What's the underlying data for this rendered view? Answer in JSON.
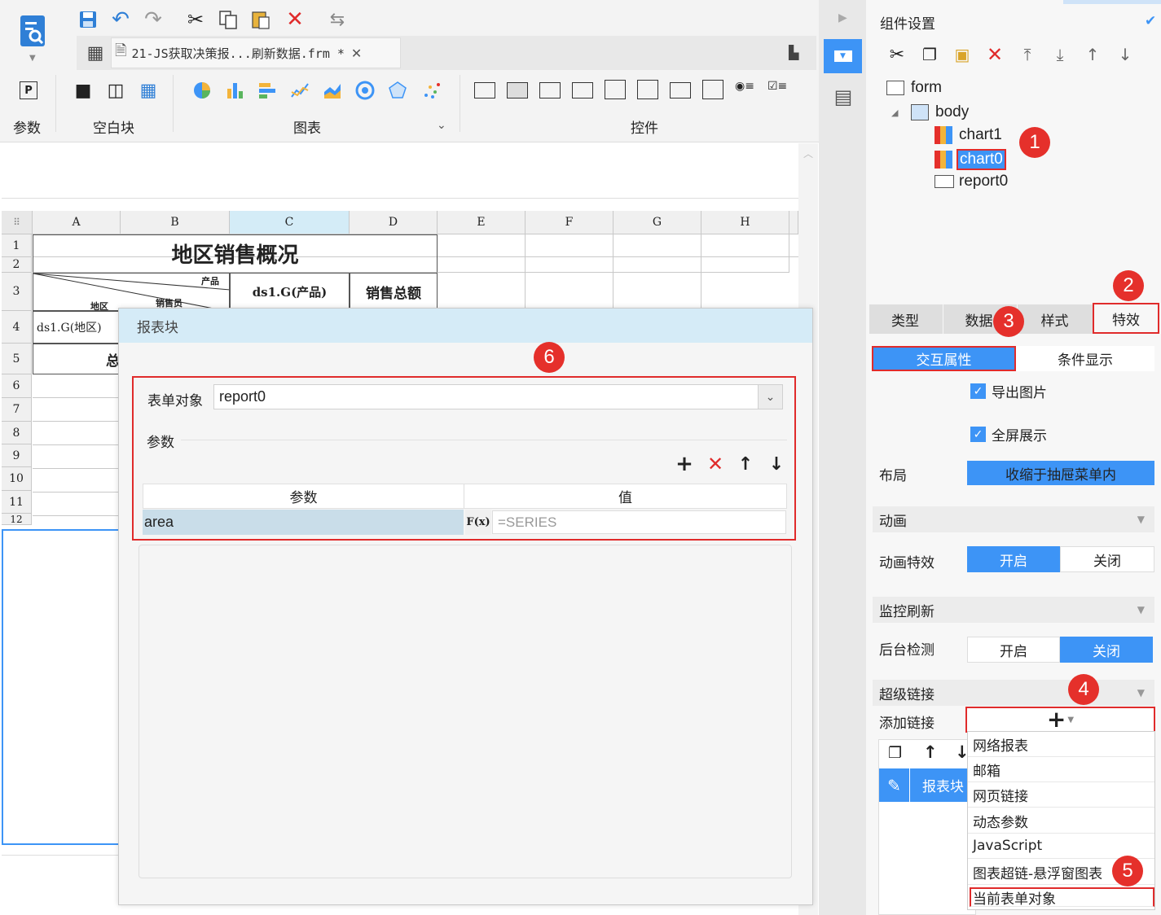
{
  "toolbar": {
    "ribbon_groups": [
      "参数",
      "空白块",
      "图表",
      "控件"
    ]
  },
  "file_tab": {
    "label": "21-JS获取决策报...刷新数据.frm *"
  },
  "sheet": {
    "columns": [
      "A",
      "B",
      "C",
      "D",
      "E",
      "F",
      "G",
      "H"
    ],
    "rows": [
      "1",
      "2",
      "3",
      "4",
      "5",
      "6",
      "7",
      "8",
      "9",
      "10",
      "11",
      "12"
    ],
    "title": "地区销售概况",
    "header_c": "ds1.G(产品)",
    "header_d": "销售总额",
    "diag_top": "产品",
    "diag_mid": "销售员",
    "diag_bot": "地区",
    "cell_a4": "ds1.G(地区)",
    "cell_a5_partial": "总"
  },
  "dialog": {
    "title": "报表块",
    "form_object_label": "表单对象",
    "form_object_value": "report0",
    "params_label": "参数",
    "col_param": "参数",
    "col_value": "值",
    "row_param": "area",
    "row_value": "=SERIES",
    "formula_icon": "F(x)"
  },
  "panel": {
    "title": "组件设置",
    "tree": {
      "form": "form",
      "body": "body",
      "items": [
        "chart1",
        "chart0",
        "report0"
      ]
    },
    "tabs": [
      "类型",
      "数据",
      "样式",
      "特效"
    ],
    "subtabs": [
      "交互属性",
      "条件显示"
    ],
    "export_image": "导出图片",
    "fullscreen": "全屏展示",
    "layout_label": "布局",
    "layout_value": "收缩于抽屉菜单内",
    "animation_section": "动画",
    "animation_label": "动画特效",
    "on": "开启",
    "off": "关闭",
    "monitor_section": "监控刷新",
    "bg_check_label": "后台检测",
    "hyperlink_section": "超级链接",
    "add_link_label": "添加链接",
    "link_item": "报表块",
    "menu": [
      "网络报表",
      "邮箱",
      "网页链接",
      "动态参数",
      "JavaScript",
      "图表超链-悬浮窗图表",
      "当前表单对象"
    ]
  },
  "callouts": [
    "1",
    "2",
    "3",
    "4",
    "5",
    "6"
  ],
  "colors": {
    "accent": "#3d94f6",
    "red": "#e02b2b",
    "dialog_header": "#d5ebf7"
  }
}
